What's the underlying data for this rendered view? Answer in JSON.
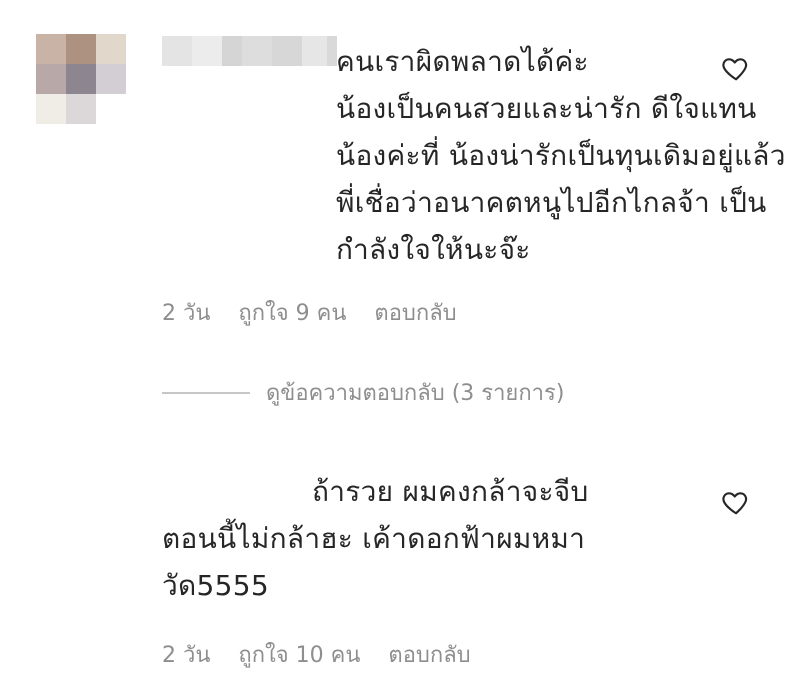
{
  "comments": [
    {
      "text": "คนเราผิดพลาดได้ค่ะ\nน้องเป็นคนสวยและน่ารัก ดีใจแทน\nน้องค่ะที่ น้องน่ารักเป็นทุนเดิมอยู่แล้ว\nพี่เชื่อว่าอนาคตหนูไปอีกไกลจ้า เป็น\nกำลังใจให้นะจ๊ะ",
      "time": "2 วัน",
      "likes": "ถูกใจ 9 คน",
      "reply": "ตอบกลับ",
      "avatar_colors": [
        "#c9b3a6",
        "#ad9282",
        "#e1d7cb",
        "#b8a8a8",
        "#8d8690",
        "#d3ced4",
        "#f0ece6",
        "#dcd7d8",
        "#ffffff"
      ],
      "username_colors": [
        "#e4e4e4",
        "#ececec",
        "#d5d5d5",
        "#dddddd",
        "#d7d7d7",
        "#e6e6e6",
        "#d9d9d9"
      ]
    },
    {
      "text": "ถ้ารวย ผมคงกล้าจะจีบ\nตอนนี้ไม่กล้าฮะ เค้าดอกฟ้าผมหมา\nวัด5555",
      "time": "2 วัน",
      "likes": "ถูกใจ 10 คน",
      "reply": "ตอบกลับ",
      "avatar_colors": [
        "#ffffff",
        "#d8dcd2",
        "#ffffff",
        "#97a589",
        "#7e8b6e",
        "#e9ece3",
        "#a29488",
        "#8d8278",
        "#eeeeee"
      ],
      "username_colors": [
        "#ececec",
        "#dcdcdc",
        "#d3d6de",
        "#cfd3dc",
        "#e0e2e6"
      ]
    }
  ],
  "view_replies": "ดูข้อความตอบกลับ (3 รายการ)",
  "colors": {
    "text": "#262626",
    "meta": "#8e8e8e",
    "divider": "#c7c7c7"
  },
  "icons": {
    "like": "heart-outline-icon"
  }
}
